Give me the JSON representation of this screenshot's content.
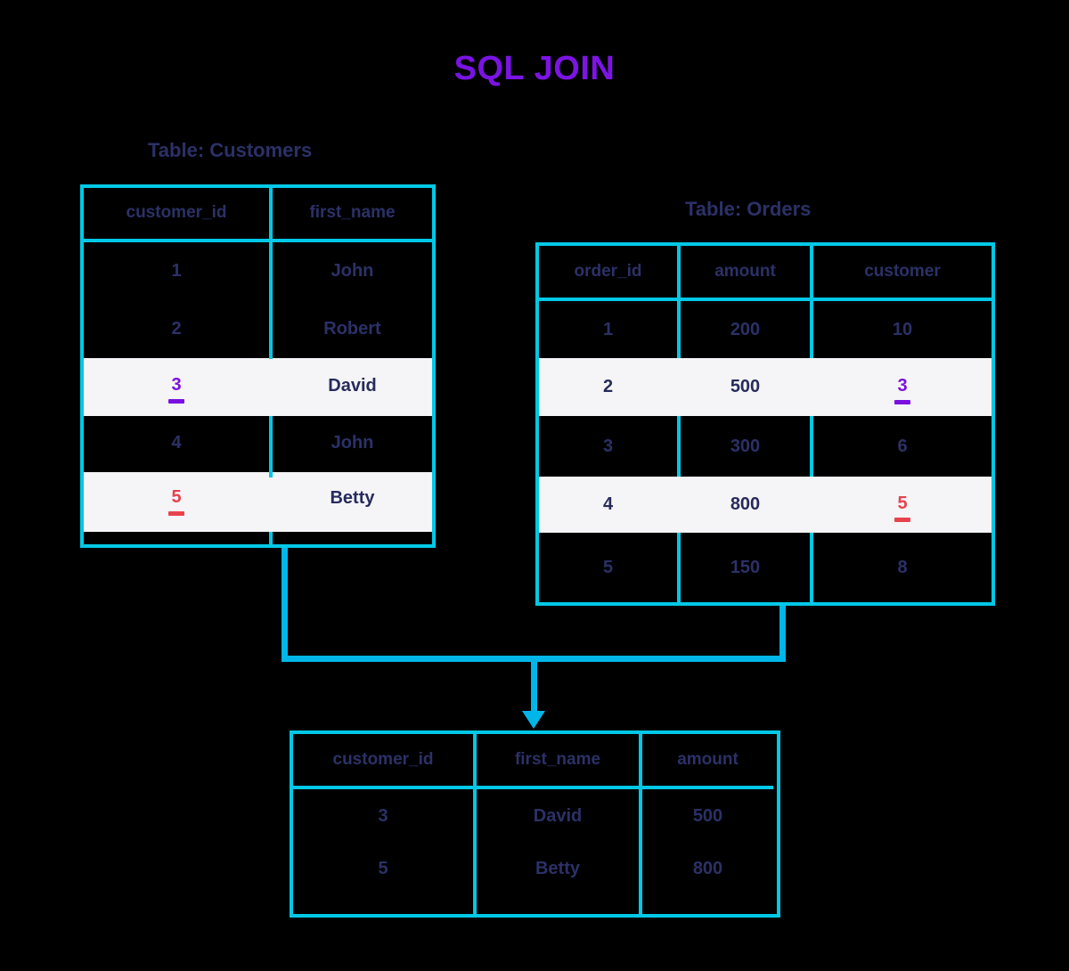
{
  "title": "SQL JOIN",
  "colors": {
    "background": "#000000",
    "border": "#00c8e6",
    "connector": "#00b6e8",
    "title": "#7b10e0",
    "text": "#2b3167",
    "highlight_bg": "#f5f5f7",
    "match_purple": "#7b10e0",
    "match_red": "#e8424c"
  },
  "customers": {
    "caption": "Table: Customers",
    "columns": [
      "customer_id",
      "first_name"
    ],
    "rows": [
      {
        "customer_id": "1",
        "first_name": "John",
        "highlight": false,
        "mark": null
      },
      {
        "customer_id": "2",
        "first_name": "Robert",
        "highlight": false,
        "mark": null
      },
      {
        "customer_id": "3",
        "first_name": "David",
        "highlight": true,
        "mark": "purple"
      },
      {
        "customer_id": "4",
        "first_name": "John",
        "highlight": false,
        "mark": null
      },
      {
        "customer_id": "5",
        "first_name": "Betty",
        "highlight": true,
        "mark": "red"
      }
    ]
  },
  "orders": {
    "caption": "Table: Orders",
    "columns": [
      "order_id",
      "amount",
      "customer"
    ],
    "rows": [
      {
        "order_id": "1",
        "amount": "200",
        "customer": "10",
        "highlight": false,
        "mark": null
      },
      {
        "order_id": "2",
        "amount": "500",
        "customer": "3",
        "highlight": true,
        "mark": "purple"
      },
      {
        "order_id": "3",
        "amount": "300",
        "customer": "6",
        "highlight": false,
        "mark": null
      },
      {
        "order_id": "4",
        "amount": "800",
        "customer": "5",
        "highlight": true,
        "mark": "red"
      },
      {
        "order_id": "5",
        "amount": "150",
        "customer": "8",
        "highlight": false,
        "mark": null
      }
    ]
  },
  "result": {
    "columns": [
      "customer_id",
      "first_name",
      "amount"
    ],
    "rows": [
      {
        "customer_id": "3",
        "first_name": "David",
        "amount": "500"
      },
      {
        "customer_id": "5",
        "first_name": "Betty",
        "amount": "800"
      }
    ]
  }
}
